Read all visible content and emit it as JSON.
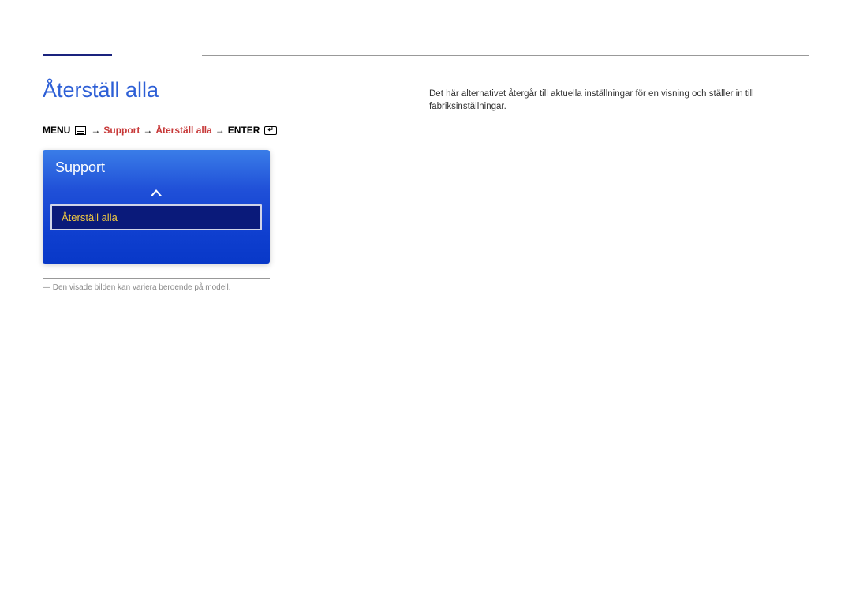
{
  "section": {
    "title": "Återställ alla"
  },
  "breadcrumb": {
    "menu": "MENU",
    "arrow": "→",
    "support": "Support",
    "reset_all": "Återställ alla",
    "enter": "ENTER"
  },
  "panel": {
    "header": "Support",
    "selected_item": "Återställ alla"
  },
  "footnote": {
    "text": "― Den visade bilden kan variera beroende på modell."
  },
  "description": {
    "text": "Det här alternativet återgår till aktuella inställningar för en visning och ställer in till fabriksinställningar."
  }
}
